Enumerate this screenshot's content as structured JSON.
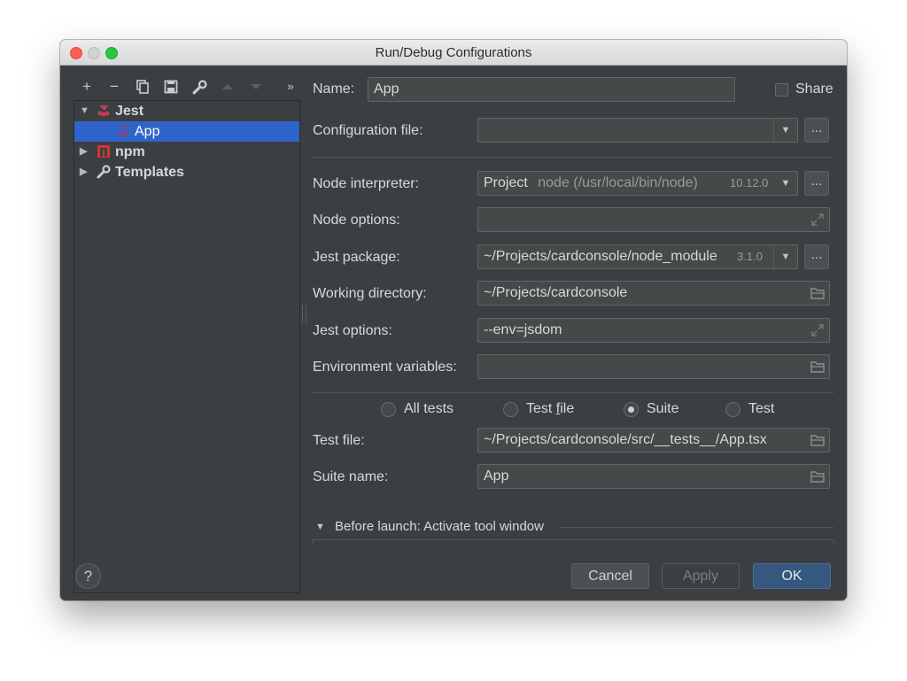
{
  "window": {
    "title": "Run/Debug Configurations"
  },
  "toolbar": {
    "add_icon": "plus-icon",
    "remove_icon": "minus-icon",
    "copy_icon": "copy-icon",
    "save_icon": "save-icon",
    "edit_icon": "wrench-icon",
    "up_icon": "arrow-up-icon",
    "down_icon": "arrow-down-icon",
    "more_icon": "double-chevron-icon"
  },
  "tree": {
    "items": [
      {
        "label": "Jest",
        "expanded": true
      },
      {
        "label": "App",
        "selected": true
      },
      {
        "label": "npm",
        "expanded": false
      },
      {
        "label": "Templates",
        "expanded": false
      }
    ]
  },
  "form": {
    "name_label": "Name:",
    "name_value": "App",
    "share_label": "Share",
    "config_file_label": "Configuration file:",
    "config_file_value": "",
    "node_interpreter_label": "Node interpreter:",
    "node_interpreter_value": "Project",
    "node_interpreter_path": "node (/usr/local/bin/node)",
    "node_interpreter_version": "10.12.0",
    "node_options_label": "Node options:",
    "node_options_value": "",
    "jest_package_label": "Jest package:",
    "jest_package_value": "~/Projects/cardconsole/node_module",
    "jest_package_version": "3.1.0",
    "working_dir_label": "Working directory:",
    "working_dir_value": "~/Projects/cardconsole",
    "jest_options_label": "Jest options:",
    "jest_options_value": "--env=jsdom",
    "env_vars_label": "Environment variables:",
    "env_vars_value": "",
    "scope_options": [
      "All tests",
      "Test file",
      "Suite",
      "Test"
    ],
    "scope_selected": "Suite",
    "test_file_label": "Test file:",
    "test_file_value": "~/Projects/cardconsole/src/__tests__/App.tsx",
    "suite_name_label": "Suite name:",
    "suite_name_value": "App",
    "before_launch_label": "Before launch: Activate tool window",
    "dots_label": "..."
  },
  "buttons": {
    "cancel": "Cancel",
    "apply": "Apply",
    "ok": "OK",
    "help": "?"
  }
}
